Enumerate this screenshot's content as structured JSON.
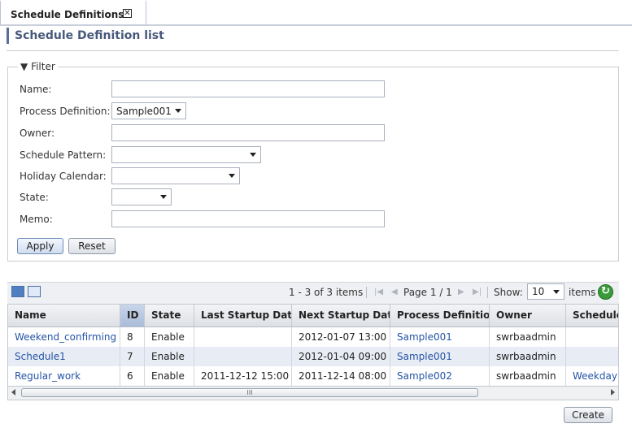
{
  "tab": {
    "label": "Schedule Definitions",
    "close_glyph": "✕"
  },
  "page": {
    "title": "Schedule Definition list"
  },
  "filter": {
    "legend": "Filter",
    "fields": {
      "name": {
        "label": "Name:",
        "value": ""
      },
      "process_definition": {
        "label": "Process Definition:",
        "value": "Sample001"
      },
      "owner": {
        "label": "Owner:",
        "value": ""
      },
      "schedule_pattern": {
        "label": "Schedule Pattern:",
        "value": ""
      },
      "holiday_calendar": {
        "label": "Holiday Calendar:",
        "value": ""
      },
      "state": {
        "label": "State:",
        "value": ""
      },
      "memo": {
        "label": "Memo:",
        "value": ""
      }
    },
    "apply_label": "Apply",
    "reset_label": "Reset"
  },
  "toolbar": {
    "range_text": "1 - 3 of 3 items",
    "page_text": "Page 1 / 1",
    "show_label": "Show:",
    "show_value": "10",
    "items_label": "items"
  },
  "grid": {
    "columns": [
      "Name",
      "ID",
      "State",
      "Last Startup Date",
      "Next Startup Date",
      "Process Definition",
      "Owner",
      "Schedule Pattern"
    ],
    "rows": [
      {
        "name": "Weekend_confirming",
        "id": "8",
        "state": "Enable",
        "last": "",
        "next": "2012-01-07 13:00",
        "process": "Sample001",
        "owner": "swrbaadmin",
        "pattern": ""
      },
      {
        "name": "Schedule1",
        "id": "7",
        "state": "Enable",
        "last": "",
        "next": "2012-01-04 09:00",
        "process": "Sample001",
        "owner": "swrbaadmin",
        "pattern": ""
      },
      {
        "name": "Regular_work",
        "id": "6",
        "state": "Enable",
        "last": "2011-12-12 15:00",
        "next": "2011-12-14 08:00",
        "process": "Sample002",
        "owner": "swrbaadmin",
        "pattern": "Weekday"
      }
    ]
  },
  "scrollbar": {
    "thumb_grip": "III"
  },
  "create_label": "Create",
  "colors": {
    "link": "#2454a6",
    "title": "#48597c",
    "sorted_header": "#b9c8e0"
  }
}
